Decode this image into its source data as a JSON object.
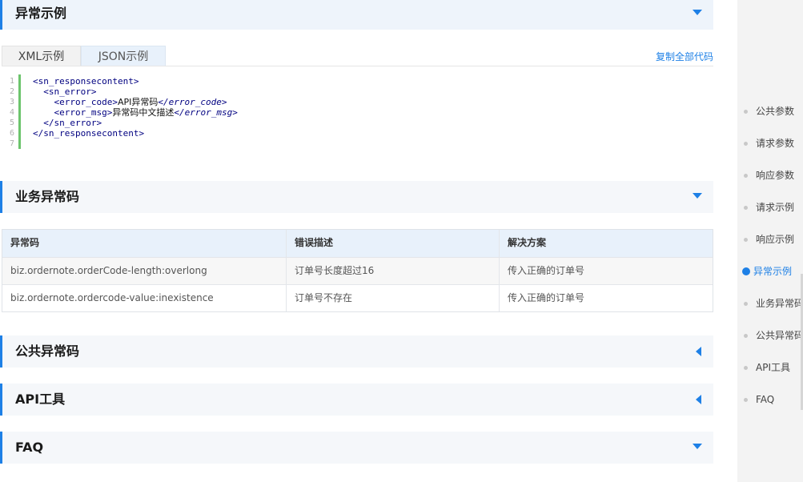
{
  "sections": {
    "example": {
      "title": "异常示例"
    },
    "biz_codes": {
      "title": "业务异常码"
    },
    "public_codes": {
      "title": "公共异常码"
    },
    "api_tool": {
      "title": "API工具"
    },
    "faq": {
      "title": "FAQ"
    }
  },
  "tabs": {
    "xml": "XML示例",
    "json": "JSON示例",
    "active": "xml"
  },
  "copy_all": "复制全部代码",
  "code": {
    "line_numbers": [
      "1",
      "2",
      "3",
      "4",
      "5",
      "6",
      "7"
    ],
    "l1": "<sn_responsecontent>",
    "l2": "  <sn_error>",
    "l3_open": "    <error_code>",
    "l3_text": "API异常码",
    "l3_close": "</error_code>",
    "l4_open": "    <error_msg>",
    "l4_text": "异常码中文描述",
    "l4_close": "</error_msg>",
    "l5": "  </sn_error>",
    "l6": "</sn_responsecontent>",
    "l7": ""
  },
  "table": {
    "headers": [
      "异常码",
      "错误描述",
      "解决方案"
    ],
    "rows": [
      [
        "biz.ordernote.orderCode-length:overlong",
        "订单号长度超过16",
        "传入正确的订单号"
      ],
      [
        "biz.ordernote.ordercode-value:inexistence",
        "订单号不存在",
        "传入正确的订单号"
      ]
    ]
  },
  "sidebar": {
    "items": [
      {
        "label": "公共参数"
      },
      {
        "label": "请求参数"
      },
      {
        "label": "响应参数"
      },
      {
        "label": "请求示例"
      },
      {
        "label": "响应示例"
      },
      {
        "label": "异常示例"
      },
      {
        "label": "业务异常码"
      },
      {
        "label": "公共异常码"
      },
      {
        "label": "API工具"
      },
      {
        "label": "FAQ"
      }
    ],
    "active_index": 5
  },
  "colors": {
    "accent": "#1e80e6",
    "code_tag": "#000080",
    "gutter_bar": "#6cc46c"
  }
}
